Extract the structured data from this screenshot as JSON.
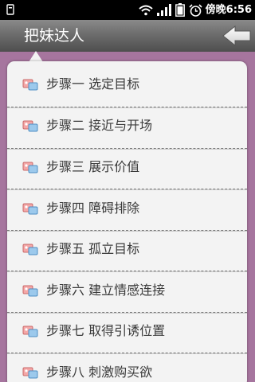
{
  "status_bar": {
    "carrier_text": "傍晚",
    "time": "6:56",
    "icons": [
      "notification-icon",
      "wifi-icon",
      "signal-icon",
      "battery-icon",
      "alarm-icon"
    ]
  },
  "title_bar": {
    "title": "把妹达人",
    "back_icon": "back-arrow-icon"
  },
  "menu": {
    "items": [
      {
        "label": "步骤一  选定目标",
        "icon": "list-item-icon"
      },
      {
        "label": "步骤二  接近与开场",
        "icon": "list-item-icon"
      },
      {
        "label": "步骤三  展示价值",
        "icon": "list-item-icon"
      },
      {
        "label": "步骤四  障碍排除",
        "icon": "list-item-icon"
      },
      {
        "label": "步骤五  孤立目标",
        "icon": "list-item-icon"
      },
      {
        "label": "步骤六  建立情感连接",
        "icon": "list-item-icon"
      },
      {
        "label": "步骤七  取得引诱位置",
        "icon": "list-item-icon"
      },
      {
        "label": "步骤八  刺激购买欲",
        "icon": "list-item-icon"
      }
    ]
  },
  "colors": {
    "background": "#a6759e",
    "menu_background": "#f3f3f3",
    "status_bar": "#000000",
    "title_bar": "#6d6d6d"
  }
}
